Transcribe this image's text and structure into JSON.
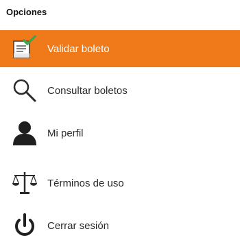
{
  "menu": {
    "title": "Opciones",
    "accent_color": "#f07a1a",
    "items": [
      {
        "label": "Validar boleto",
        "icon": "ticket-check-icon",
        "active": true
      },
      {
        "label": "Consultar boletos",
        "icon": "search-icon",
        "active": false
      },
      {
        "label": "Mi perfil",
        "icon": "user-icon",
        "active": false
      },
      {
        "label": "Términos de uso",
        "icon": "scales-icon",
        "active": false
      },
      {
        "label": "Cerrar sesión",
        "icon": "power-icon",
        "active": false
      }
    ]
  }
}
